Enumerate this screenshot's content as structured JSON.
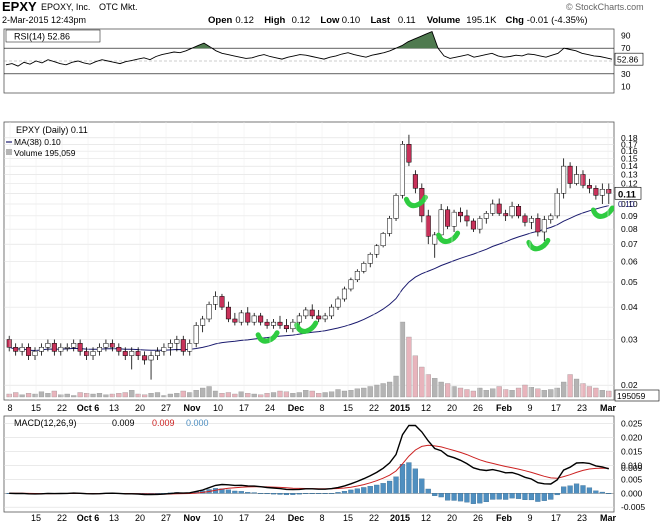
{
  "header": {
    "symbol": "EPXY",
    "company": "EPOXY, Inc.",
    "exchange": "OTC Mkt.",
    "watermark": "© StockCharts.com",
    "date": "2-Mar-2015 12:43pm",
    "quote": [
      {
        "label": "Open",
        "value": "0.12"
      },
      {
        "label": "High",
        "value": "0.12"
      },
      {
        "label": "Low",
        "value": "0.10"
      },
      {
        "label": "Last",
        "value": "0.11"
      },
      {
        "label": "Volume",
        "value": "195.1K"
      },
      {
        "label": "Chg",
        "value": "-0.01 (-4.35%)"
      }
    ]
  },
  "colors": {
    "up": "#ffffff",
    "down": "#c8325a",
    "candle_outline": "#000000",
    "ma": "#1a1a6e",
    "rsi": "#000000",
    "rsi_fill": "#4f7a4f",
    "vol_up": "#b4b4b4",
    "vol_down": "#e8b4bc",
    "macd": "#000000",
    "signal": "#cc2222",
    "hist": "#4f8fc0",
    "annotation": "#2ecc40",
    "grid": "#dddddd"
  },
  "chart_data": [
    {
      "type": "line",
      "panel": "rsi",
      "legend": "RSI(14) 52.86",
      "legend_value": "52.86",
      "ylim": [
        0,
        100
      ],
      "ticks": [
        90,
        70,
        50,
        30,
        10
      ],
      "ref_lines": [
        70,
        30
      ],
      "values": [
        44,
        46,
        42,
        48,
        45,
        50,
        47,
        52,
        49,
        46,
        44,
        48,
        50,
        47,
        45,
        49,
        52,
        50,
        48,
        46,
        49,
        51,
        53,
        55,
        52,
        57,
        60,
        62,
        64,
        63,
        66,
        70,
        74,
        78,
        72,
        66,
        62,
        60,
        58,
        56,
        54,
        55,
        58,
        60,
        57,
        55,
        53,
        56,
        58,
        60,
        59,
        57,
        55,
        53,
        56,
        58,
        61,
        63,
        60,
        58,
        56,
        59,
        61,
        63,
        66,
        70,
        74,
        80,
        84,
        88,
        92,
        96,
        70,
        58,
        54,
        56,
        58,
        60,
        56,
        58,
        60,
        62,
        58,
        56,
        57,
        59,
        58,
        61,
        60,
        58,
        56,
        59,
        62,
        70,
        68,
        66,
        62,
        60,
        58,
        57,
        55,
        52.86
      ]
    },
    {
      "type": "candlestick",
      "panel": "price",
      "legend": [
        "EPXY (Daily) 0.11",
        "MA(38) 0.10",
        "Volume 195,059"
      ],
      "scale": "log",
      "ylim": [
        0.018,
        0.2
      ],
      "y_ticks": [
        0.18,
        0.17,
        0.16,
        0.15,
        0.14,
        0.13,
        0.12,
        0.11,
        0.1,
        0.09,
        0.08,
        0.07,
        0.06,
        0.05,
        0.04,
        0.03,
        0.02
      ],
      "last_price_label": "0.11",
      "ma_label": "0.10",
      "volume_label": "195059",
      "x_tick_labels": [
        "8",
        "15",
        "22",
        "Oct 6",
        "13",
        "20",
        "27",
        "Nov",
        "10",
        "17",
        "24",
        "Dec",
        "8",
        "15",
        "22",
        "2015",
        "12",
        "20",
        "26",
        "Feb",
        "9",
        "17",
        "23",
        "Mar"
      ],
      "ohlc": [
        [
          0.03,
          0.031,
          0.027,
          0.028
        ],
        [
          0.028,
          0.029,
          0.026,
          0.027
        ],
        [
          0.027,
          0.029,
          0.026,
          0.028
        ],
        [
          0.028,
          0.029,
          0.025,
          0.026
        ],
        [
          0.026,
          0.028,
          0.025,
          0.027
        ],
        [
          0.027,
          0.029,
          0.026,
          0.028
        ],
        [
          0.028,
          0.03,
          0.027,
          0.029
        ],
        [
          0.029,
          0.03,
          0.026,
          0.027
        ],
        [
          0.027,
          0.029,
          0.026,
          0.028
        ],
        [
          0.028,
          0.029,
          0.027,
          0.028
        ],
        [
          0.028,
          0.03,
          0.027,
          0.029
        ],
        [
          0.029,
          0.03,
          0.026,
          0.027
        ],
        [
          0.027,
          0.028,
          0.025,
          0.026
        ],
        [
          0.026,
          0.028,
          0.025,
          0.027
        ],
        [
          0.027,
          0.029,
          0.026,
          0.028
        ],
        [
          0.028,
          0.03,
          0.027,
          0.029
        ],
        [
          0.029,
          0.03,
          0.027,
          0.028
        ],
        [
          0.028,
          0.029,
          0.026,
          0.027
        ],
        [
          0.027,
          0.028,
          0.025,
          0.026
        ],
        [
          0.026,
          0.028,
          0.023,
          0.027
        ],
        [
          0.027,
          0.028,
          0.025,
          0.026
        ],
        [
          0.026,
          0.027,
          0.024,
          0.025
        ],
        [
          0.025,
          0.027,
          0.021,
          0.026
        ],
        [
          0.026,
          0.028,
          0.025,
          0.027
        ],
        [
          0.027,
          0.029,
          0.026,
          0.028
        ],
        [
          0.028,
          0.03,
          0.026,
          0.029
        ],
        [
          0.029,
          0.031,
          0.027,
          0.03
        ],
        [
          0.03,
          0.031,
          0.026,
          0.027
        ],
        [
          0.027,
          0.03,
          0.026,
          0.029
        ],
        [
          0.029,
          0.035,
          0.028,
          0.034
        ],
        [
          0.034,
          0.037,
          0.032,
          0.036
        ],
        [
          0.036,
          0.042,
          0.035,
          0.041
        ],
        [
          0.041,
          0.046,
          0.039,
          0.044
        ],
        [
          0.044,
          0.045,
          0.039,
          0.04
        ],
        [
          0.04,
          0.042,
          0.035,
          0.036
        ],
        [
          0.036,
          0.038,
          0.034,
          0.035
        ],
        [
          0.035,
          0.039,
          0.034,
          0.038
        ],
        [
          0.038,
          0.04,
          0.034,
          0.035
        ],
        [
          0.035,
          0.038,
          0.034,
          0.037
        ],
        [
          0.037,
          0.038,
          0.034,
          0.035
        ],
        [
          0.035,
          0.036,
          0.033,
          0.034
        ],
        [
          0.034,
          0.036,
          0.033,
          0.035
        ],
        [
          0.035,
          0.037,
          0.033,
          0.034
        ],
        [
          0.034,
          0.036,
          0.032,
          0.033
        ],
        [
          0.033,
          0.036,
          0.032,
          0.035
        ],
        [
          0.035,
          0.038,
          0.034,
          0.037
        ],
        [
          0.037,
          0.04,
          0.036,
          0.039
        ],
        [
          0.039,
          0.041,
          0.036,
          0.037
        ],
        [
          0.037,
          0.039,
          0.035,
          0.036
        ],
        [
          0.036,
          0.038,
          0.035,
          0.037
        ],
        [
          0.037,
          0.041,
          0.036,
          0.04
        ],
        [
          0.04,
          0.044,
          0.039,
          0.043
        ],
        [
          0.043,
          0.048,
          0.042,
          0.047
        ],
        [
          0.047,
          0.052,
          0.046,
          0.051
        ],
        [
          0.051,
          0.056,
          0.05,
          0.055
        ],
        [
          0.055,
          0.06,
          0.054,
          0.059
        ],
        [
          0.059,
          0.065,
          0.057,
          0.064
        ],
        [
          0.064,
          0.07,
          0.062,
          0.069
        ],
        [
          0.069,
          0.078,
          0.068,
          0.077
        ],
        [
          0.077,
          0.09,
          0.075,
          0.088
        ],
        [
          0.088,
          0.11,
          0.086,
          0.108
        ],
        [
          0.108,
          0.175,
          0.105,
          0.17
        ],
        [
          0.17,
          0.185,
          0.14,
          0.145
        ],
        [
          0.13,
          0.135,
          0.11,
          0.115
        ],
        [
          0.115,
          0.12,
          0.085,
          0.09
        ],
        [
          0.09,
          0.095,
          0.07,
          0.075
        ],
        [
          0.07,
          0.078,
          0.062,
          0.076
        ],
        [
          0.076,
          0.1,
          0.072,
          0.095
        ],
        [
          0.095,
          0.098,
          0.08,
          0.082
        ],
        [
          0.082,
          0.095,
          0.078,
          0.093
        ],
        [
          0.093,
          0.097,
          0.085,
          0.09
        ],
        [
          0.09,
          0.095,
          0.082,
          0.086
        ],
        [
          0.086,
          0.088,
          0.078,
          0.08
        ],
        [
          0.08,
          0.09,
          0.077,
          0.088
        ],
        [
          0.088,
          0.094,
          0.084,
          0.092
        ],
        [
          0.092,
          0.104,
          0.09,
          0.1
        ],
        [
          0.1,
          0.105,
          0.09,
          0.092
        ],
        [
          0.092,
          0.095,
          0.086,
          0.09
        ],
        [
          0.09,
          0.102,
          0.088,
          0.098
        ],
        [
          0.098,
          0.1,
          0.088,
          0.09
        ],
        [
          0.09,
          0.092,
          0.082,
          0.085
        ],
        [
          0.085,
          0.09,
          0.08,
          0.088
        ],
        [
          0.088,
          0.092,
          0.075,
          0.078
        ],
        [
          0.078,
          0.09,
          0.072,
          0.087
        ],
        [
          0.087,
          0.092,
          0.084,
          0.09
        ],
        [
          0.09,
          0.115,
          0.088,
          0.11
        ],
        [
          0.11,
          0.15,
          0.105,
          0.14
        ],
        [
          0.14,
          0.145,
          0.115,
          0.12
        ],
        [
          0.12,
          0.14,
          0.118,
          0.13
        ],
        [
          0.13,
          0.135,
          0.115,
          0.118
        ],
        [
          0.118,
          0.125,
          0.11,
          0.115
        ],
        [
          0.115,
          0.118,
          0.104,
          0.108
        ],
        [
          0.108,
          0.12,
          0.1,
          0.114
        ],
        [
          0.114,
          0.12,
          0.1,
          0.11
        ]
      ],
      "volume": [
        4,
        6,
        3,
        5,
        4,
        7,
        5,
        8,
        3,
        4,
        2,
        6,
        5,
        4,
        5,
        3,
        4,
        5,
        6,
        9,
        4,
        3,
        5,
        6,
        2,
        4,
        5,
        8,
        6,
        9,
        12,
        14,
        8,
        5,
        6,
        4,
        7,
        5,
        4,
        3,
        5,
        6,
        8,
        7,
        5,
        6,
        9,
        8,
        5,
        6,
        7,
        10,
        8,
        9,
        11,
        12,
        14,
        16,
        18,
        20,
        28,
        100,
        80,
        55,
        40,
        30,
        25,
        20,
        18,
        14,
        12,
        10,
        8,
        12,
        9,
        11,
        14,
        10,
        9,
        12,
        16,
        13,
        11,
        9,
        10,
        12,
        20,
        30,
        24,
        18,
        14,
        12,
        9,
        8
      ],
      "annotations": [
        {
          "shape": "swoosh",
          "near_bar": 40
        },
        {
          "shape": "swoosh",
          "near_bar": 46
        },
        {
          "shape": "swoosh",
          "near_bar": 63
        },
        {
          "shape": "swoosh",
          "near_bar": 68
        },
        {
          "shape": "swoosh",
          "near_bar": 82
        },
        {
          "shape": "swoosh",
          "near_bar": 92
        }
      ]
    },
    {
      "type": "line",
      "panel": "macd",
      "legend_prefix": "MACD(12,26,9)",
      "legend_values": [
        "0.009",
        "0.009",
        "0.000"
      ],
      "ylim": [
        -0.006,
        0.027
      ],
      "y_ticks": [
        0.025,
        0.02,
        0.015,
        0.01,
        0.005,
        0.0,
        -0.005
      ],
      "y_tick_labels": [
        "0.025",
        "0.020",
        "0.015",
        "0.010",
        "0.009",
        "0.005",
        "0.000",
        "-0.005"
      ],
      "x_tick_labels": [
        "15",
        "22",
        "Oct 6",
        "13",
        "20",
        "27",
        "Nov",
        "10",
        "17",
        "24",
        "Dec",
        "8",
        "15",
        "22",
        "2015",
        "12",
        "20",
        "26",
        "Feb",
        "9",
        "17",
        "23",
        "Mar"
      ]
    }
  ]
}
